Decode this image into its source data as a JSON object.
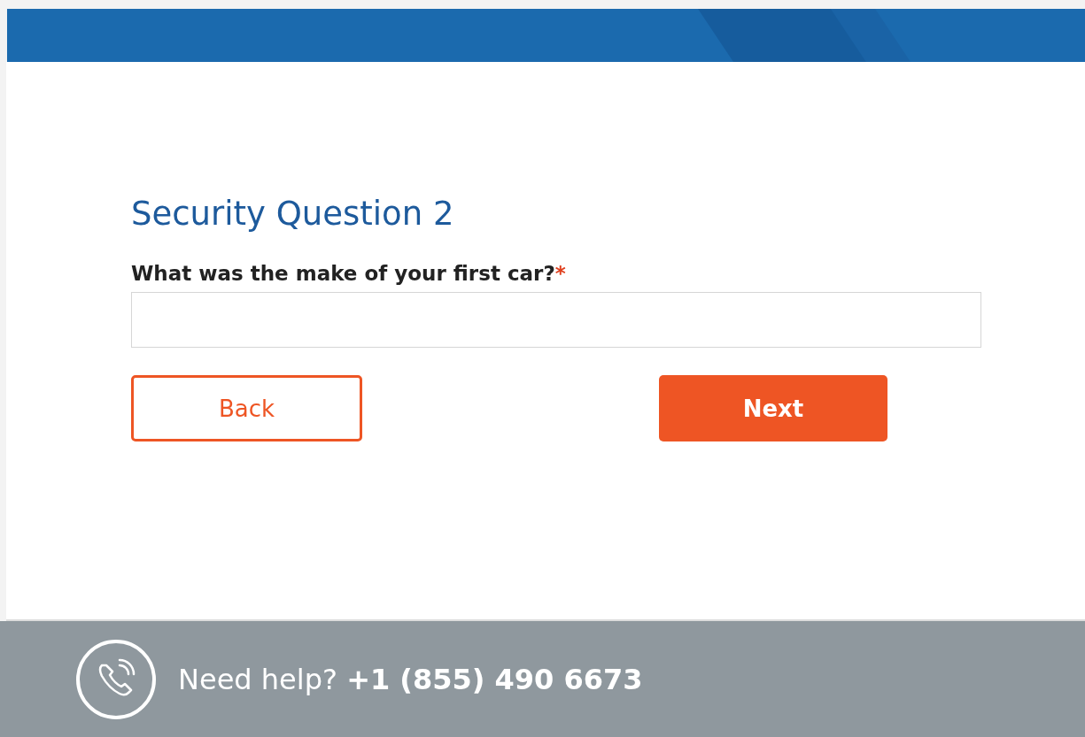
{
  "title": "Security Question 2",
  "question": {
    "label": "What was the make of your first car?",
    "required_mark": "*"
  },
  "buttons": [
    {
      "label": "Back",
      "kind": "secondary"
    },
    {
      "label": "Next",
      "kind": "primary"
    }
  ],
  "footer": {
    "help": "Need help? **+1 (855) 490 6673**"
  }
}
